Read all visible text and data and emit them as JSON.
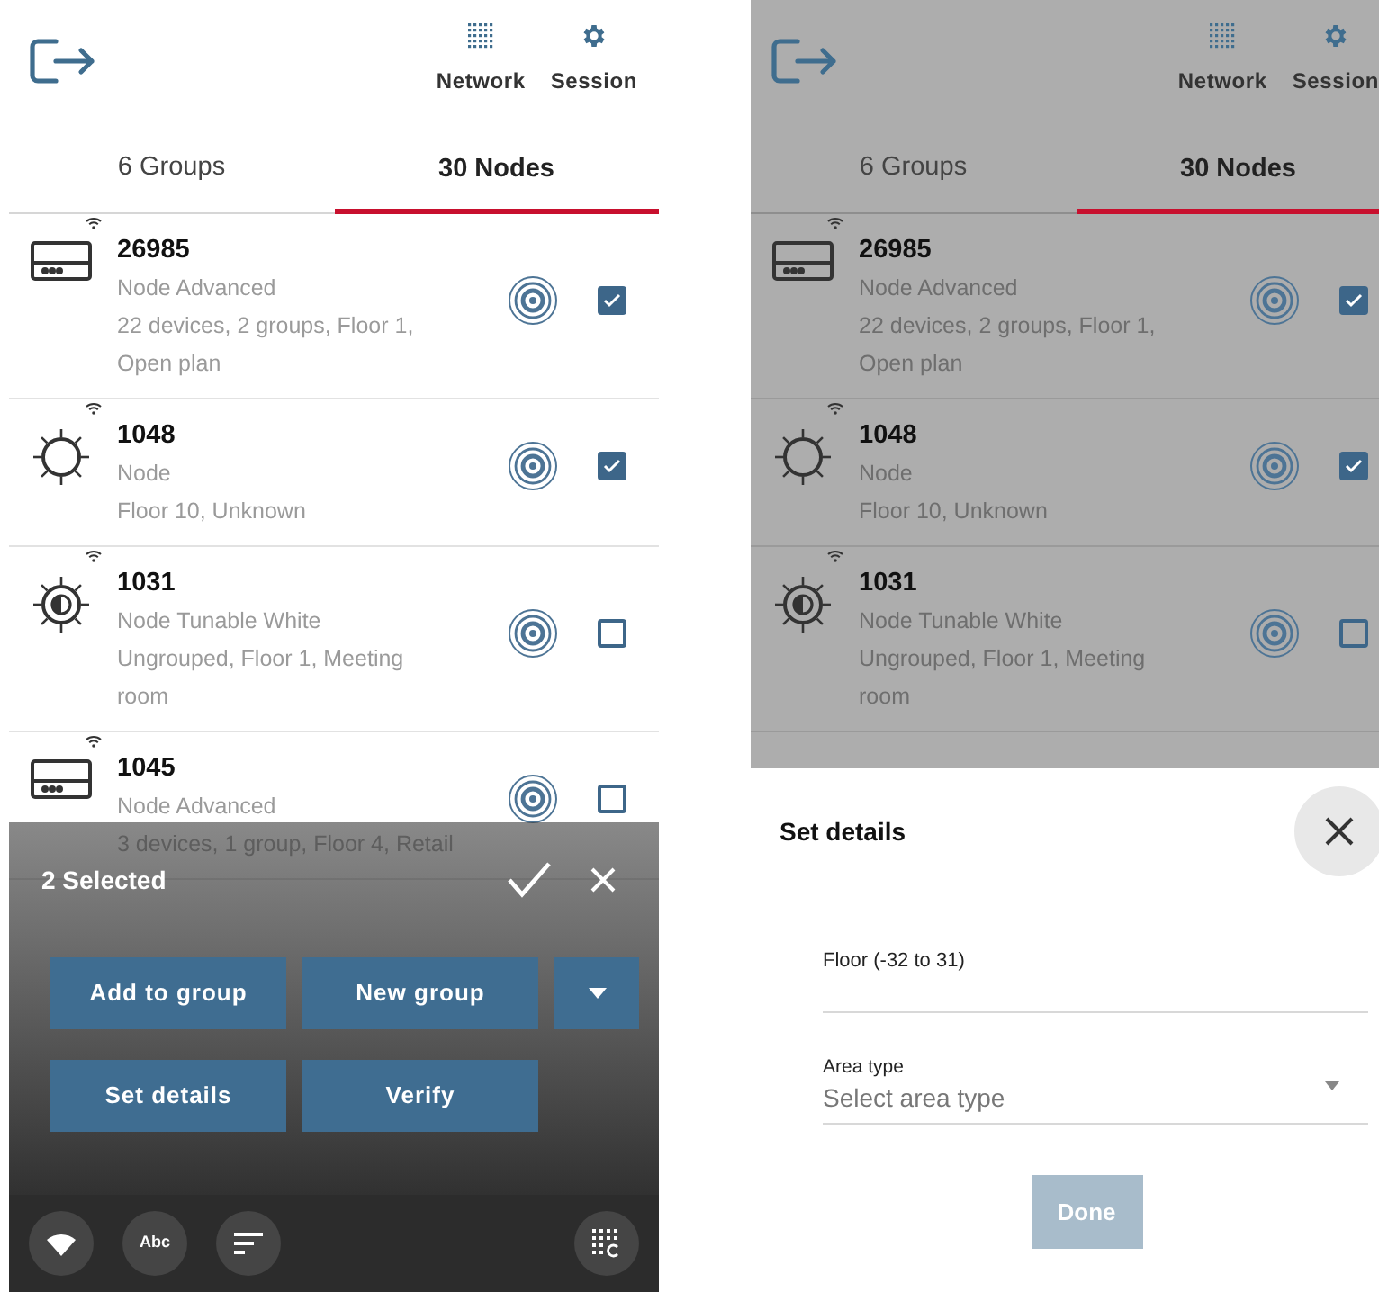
{
  "screens": [
    {
      "dimmed": false,
      "header": {
        "actions": [
          {
            "kind": "network",
            "label": "Network"
          },
          {
            "kind": "session",
            "label": "Session"
          }
        ]
      },
      "tabs": [
        {
          "label": "6 Groups",
          "selected": false
        },
        {
          "label": "30 Nodes",
          "selected": true
        }
      ],
      "nodes": [
        {
          "kind": "panel",
          "title": "26985",
          "type": "Node Advanced",
          "detail": "22 devices, 2 groups, Floor 1, Open plan",
          "checked": true
        },
        {
          "kind": "bulb",
          "title": "1048",
          "type": "Node",
          "detail": "Floor 10, Unknown",
          "checked": true
        },
        {
          "kind": "tunable",
          "title": "1031",
          "type": "Node Tunable White",
          "detail": "Ungrouped, Floor 1, Meeting room",
          "checked": false
        },
        {
          "kind": "panel",
          "title": "1045",
          "type": "Node Advanced",
          "detail": "3 devices, 1 group, Floor 4, Retail",
          "checked": false
        }
      ],
      "selection_bar": {
        "title": "2 Selected",
        "buttons": [
          {
            "kind": "text",
            "label": "Add to group"
          },
          {
            "kind": "text",
            "label": "New group"
          },
          {
            "kind": "caret"
          },
          {
            "kind": "text",
            "label": "Set details"
          },
          {
            "kind": "text",
            "label": "Verify"
          }
        ]
      },
      "toolbar": [
        {
          "kind": "wifi"
        },
        {
          "kind": "text",
          "label": "Abc"
        },
        {
          "kind": "sort"
        },
        {
          "kind": "grid"
        }
      ]
    },
    {
      "dimmed": true,
      "header": {
        "actions": [
          {
            "kind": "network",
            "label": "Network"
          },
          {
            "kind": "session",
            "label": "Session"
          }
        ]
      },
      "tabs": [
        {
          "label": "6 Groups",
          "selected": false
        },
        {
          "label": "30 Nodes",
          "selected": true
        }
      ],
      "nodes": [
        {
          "kind": "panel",
          "title": "26985",
          "type": "Node Advanced",
          "detail": "22 devices, 2 groups, Floor 1, Open plan",
          "checked": true
        },
        {
          "kind": "bulb",
          "title": "1048",
          "type": "Node",
          "detail": "Floor 10, Unknown",
          "checked": true
        },
        {
          "kind": "tunable",
          "title": "1031",
          "type": "Node Tunable White",
          "detail": "Ungrouped, Floor 1, Meeting room",
          "checked": false
        }
      ],
      "details_sheet": {
        "title": "Set details",
        "floor_field": {
          "label": "Floor (-32 to 31)"
        },
        "area_field": {
          "label": "Area type",
          "placeholder": "Select area type"
        },
        "done_button": {
          "label": "Done",
          "disabled": true
        }
      }
    }
  ]
}
